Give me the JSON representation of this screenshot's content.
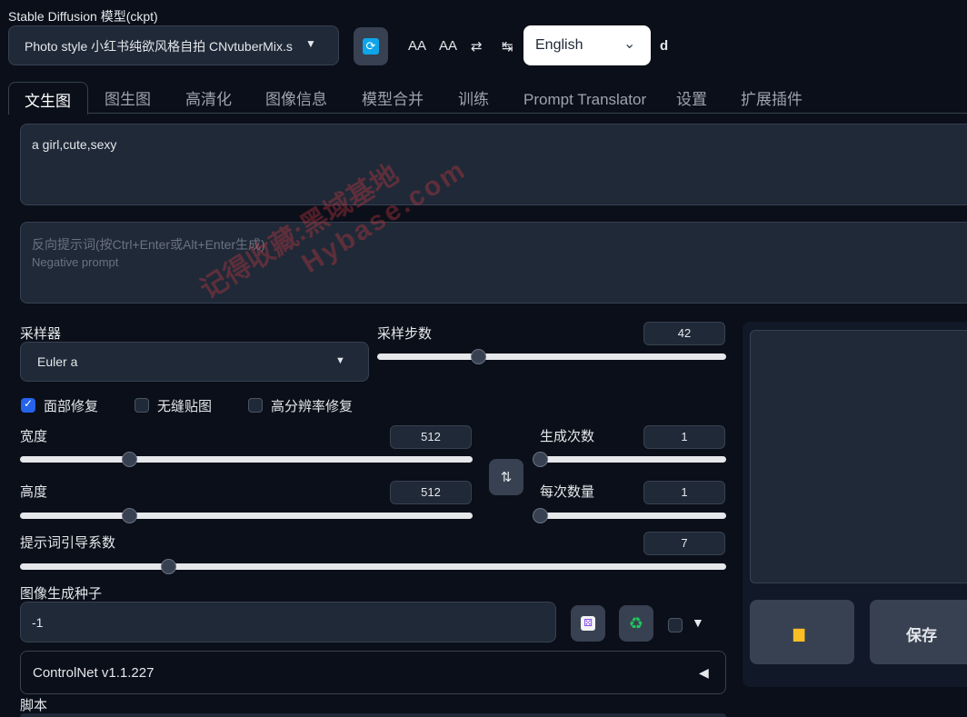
{
  "header": {
    "model_label": "Stable Diffusion 模型(ckpt)",
    "model_value": "Photo style 小红书纯欲风格自拍 CNvtuberMix.s",
    "refresh_icon": "refresh-icon",
    "tools": [
      "AA",
      "AA",
      "⇄",
      "↹"
    ],
    "language": "English",
    "extra": "d"
  },
  "tabs": [
    "文生图",
    "图生图",
    "高清化",
    "图像信息",
    "模型合并",
    "训练",
    "Prompt Translator",
    "设置",
    "扩展插件"
  ],
  "prompt": {
    "value": "a girl,cute,sexy",
    "negative_placeholder_line1": "反向提示词(按Ctrl+Enter或Alt+Enter生成)",
    "negative_placeholder_line2": "Negative prompt"
  },
  "sampler": {
    "label": "采样器",
    "value": "Euler a"
  },
  "steps": {
    "label": "采样步数",
    "value": "42",
    "fraction": 0.29
  },
  "checkboxes": [
    {
      "label": "面部修复",
      "checked": true
    },
    {
      "label": "无缝贴图",
      "checked": false
    },
    {
      "label": "高分辨率修复",
      "checked": false
    }
  ],
  "width": {
    "label": "宽度",
    "value": "512",
    "fraction": 0.24
  },
  "height": {
    "label": "高度",
    "value": "512",
    "fraction": 0.24
  },
  "batch_count": {
    "label": "生成次数",
    "value": "1",
    "fraction": 0.0
  },
  "batch_size": {
    "label": "每次数量",
    "value": "1",
    "fraction": 0.0
  },
  "cfg": {
    "label": "提示词引导系数",
    "value": "7",
    "fraction": 0.21
  },
  "seed": {
    "label": "图像生成种子",
    "value": "-1"
  },
  "controlnet": {
    "label": "ControlNet v1.1.227",
    "arrow": "◀"
  },
  "script_label": "脚本",
  "output": {
    "save_label": "保存"
  },
  "watermark": {
    "line1": "记得收藏:黑域基地",
    "line2": "Hybase.com"
  }
}
